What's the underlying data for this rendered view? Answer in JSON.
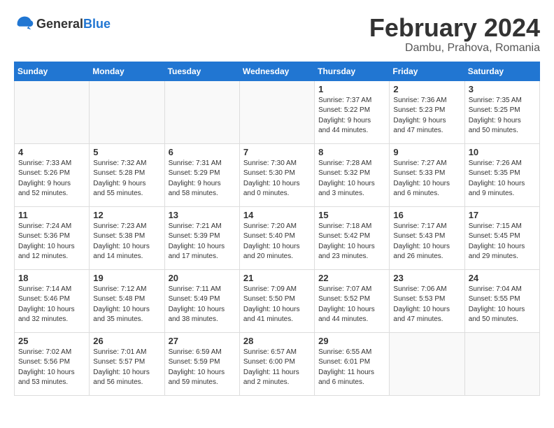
{
  "logo": {
    "general": "General",
    "blue": "Blue"
  },
  "title": {
    "month_year": "February 2024",
    "location": "Dambu, Prahova, Romania"
  },
  "headers": [
    "Sunday",
    "Monday",
    "Tuesday",
    "Wednesday",
    "Thursday",
    "Friday",
    "Saturday"
  ],
  "weeks": [
    [
      {
        "day": "",
        "detail": ""
      },
      {
        "day": "",
        "detail": ""
      },
      {
        "day": "",
        "detail": ""
      },
      {
        "day": "",
        "detail": ""
      },
      {
        "day": "1",
        "detail": "Sunrise: 7:37 AM\nSunset: 5:22 PM\nDaylight: 9 hours\nand 44 minutes."
      },
      {
        "day": "2",
        "detail": "Sunrise: 7:36 AM\nSunset: 5:23 PM\nDaylight: 9 hours\nand 47 minutes."
      },
      {
        "day": "3",
        "detail": "Sunrise: 7:35 AM\nSunset: 5:25 PM\nDaylight: 9 hours\nand 50 minutes."
      }
    ],
    [
      {
        "day": "4",
        "detail": "Sunrise: 7:33 AM\nSunset: 5:26 PM\nDaylight: 9 hours\nand 52 minutes."
      },
      {
        "day": "5",
        "detail": "Sunrise: 7:32 AM\nSunset: 5:28 PM\nDaylight: 9 hours\nand 55 minutes."
      },
      {
        "day": "6",
        "detail": "Sunrise: 7:31 AM\nSunset: 5:29 PM\nDaylight: 9 hours\nand 58 minutes."
      },
      {
        "day": "7",
        "detail": "Sunrise: 7:30 AM\nSunset: 5:30 PM\nDaylight: 10 hours\nand 0 minutes."
      },
      {
        "day": "8",
        "detail": "Sunrise: 7:28 AM\nSunset: 5:32 PM\nDaylight: 10 hours\nand 3 minutes."
      },
      {
        "day": "9",
        "detail": "Sunrise: 7:27 AM\nSunset: 5:33 PM\nDaylight: 10 hours\nand 6 minutes."
      },
      {
        "day": "10",
        "detail": "Sunrise: 7:26 AM\nSunset: 5:35 PM\nDaylight: 10 hours\nand 9 minutes."
      }
    ],
    [
      {
        "day": "11",
        "detail": "Sunrise: 7:24 AM\nSunset: 5:36 PM\nDaylight: 10 hours\nand 12 minutes."
      },
      {
        "day": "12",
        "detail": "Sunrise: 7:23 AM\nSunset: 5:38 PM\nDaylight: 10 hours\nand 14 minutes."
      },
      {
        "day": "13",
        "detail": "Sunrise: 7:21 AM\nSunset: 5:39 PM\nDaylight: 10 hours\nand 17 minutes."
      },
      {
        "day": "14",
        "detail": "Sunrise: 7:20 AM\nSunset: 5:40 PM\nDaylight: 10 hours\nand 20 minutes."
      },
      {
        "day": "15",
        "detail": "Sunrise: 7:18 AM\nSunset: 5:42 PM\nDaylight: 10 hours\nand 23 minutes."
      },
      {
        "day": "16",
        "detail": "Sunrise: 7:17 AM\nSunset: 5:43 PM\nDaylight: 10 hours\nand 26 minutes."
      },
      {
        "day": "17",
        "detail": "Sunrise: 7:15 AM\nSunset: 5:45 PM\nDaylight: 10 hours\nand 29 minutes."
      }
    ],
    [
      {
        "day": "18",
        "detail": "Sunrise: 7:14 AM\nSunset: 5:46 PM\nDaylight: 10 hours\nand 32 minutes."
      },
      {
        "day": "19",
        "detail": "Sunrise: 7:12 AM\nSunset: 5:48 PM\nDaylight: 10 hours\nand 35 minutes."
      },
      {
        "day": "20",
        "detail": "Sunrise: 7:11 AM\nSunset: 5:49 PM\nDaylight: 10 hours\nand 38 minutes."
      },
      {
        "day": "21",
        "detail": "Sunrise: 7:09 AM\nSunset: 5:50 PM\nDaylight: 10 hours\nand 41 minutes."
      },
      {
        "day": "22",
        "detail": "Sunrise: 7:07 AM\nSunset: 5:52 PM\nDaylight: 10 hours\nand 44 minutes."
      },
      {
        "day": "23",
        "detail": "Sunrise: 7:06 AM\nSunset: 5:53 PM\nDaylight: 10 hours\nand 47 minutes."
      },
      {
        "day": "24",
        "detail": "Sunrise: 7:04 AM\nSunset: 5:55 PM\nDaylight: 10 hours\nand 50 minutes."
      }
    ],
    [
      {
        "day": "25",
        "detail": "Sunrise: 7:02 AM\nSunset: 5:56 PM\nDaylight: 10 hours\nand 53 minutes."
      },
      {
        "day": "26",
        "detail": "Sunrise: 7:01 AM\nSunset: 5:57 PM\nDaylight: 10 hours\nand 56 minutes."
      },
      {
        "day": "27",
        "detail": "Sunrise: 6:59 AM\nSunset: 5:59 PM\nDaylight: 10 hours\nand 59 minutes."
      },
      {
        "day": "28",
        "detail": "Sunrise: 6:57 AM\nSunset: 6:00 PM\nDaylight: 11 hours\nand 2 minutes."
      },
      {
        "day": "29",
        "detail": "Sunrise: 6:55 AM\nSunset: 6:01 PM\nDaylight: 11 hours\nand 6 minutes."
      },
      {
        "day": "",
        "detail": ""
      },
      {
        "day": "",
        "detail": ""
      }
    ]
  ]
}
